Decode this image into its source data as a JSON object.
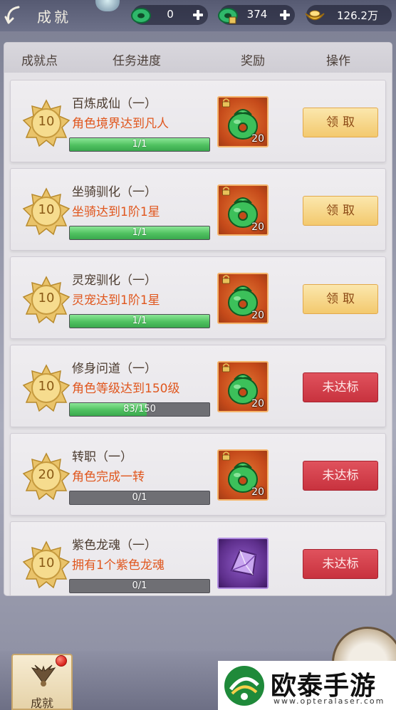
{
  "header": {
    "title": "成就",
    "currencies": [
      {
        "icon": "green-jade-icon",
        "value": "0"
      },
      {
        "icon": "bound-jade-icon",
        "value": "374"
      },
      {
        "icon": "gold-ingot-icon",
        "value": "126.2万"
      }
    ]
  },
  "table": {
    "columns": [
      "成就点",
      "任务进度",
      "奖励",
      "操作"
    ]
  },
  "achievements": [
    {
      "points": "10",
      "title": "百炼成仙（一）",
      "desc": "角色境界达到凡人",
      "progress_text": "1/1",
      "progress": 1.0,
      "reward_icon": "jade-pouch-icon",
      "reward_count": "20",
      "action": "领取",
      "state": "claimable"
    },
    {
      "points": "10",
      "title": "坐骑驯化（一）",
      "desc": "坐骑达到1阶1星",
      "progress_text": "1/1",
      "progress": 1.0,
      "reward_icon": "jade-pouch-icon",
      "reward_count": "20",
      "action": "领取",
      "state": "claimable"
    },
    {
      "points": "10",
      "title": "灵宠驯化（一）",
      "desc": "灵宠达到1阶1星",
      "progress_text": "1/1",
      "progress": 1.0,
      "reward_icon": "jade-pouch-icon",
      "reward_count": "20",
      "action": "领取",
      "state": "claimable"
    },
    {
      "points": "10",
      "title": "修身问道（一）",
      "desc": "角色等级达到150级",
      "progress_text": "83/150",
      "progress": 0.553,
      "reward_icon": "jade-pouch-icon",
      "reward_count": "20",
      "action": "未达标",
      "state": "locked"
    },
    {
      "points": "20",
      "title": "转职（一）",
      "desc": "角色完成一转",
      "progress_text": "0/1",
      "progress": 0.0,
      "reward_icon": "jade-pouch-icon",
      "reward_count": "20",
      "action": "未达标",
      "state": "locked"
    },
    {
      "points": "10",
      "title": "紫色龙魂（一）",
      "desc": "拥有1个紫色龙魂",
      "progress_text": "0/1",
      "progress": 0.0,
      "reward_icon": "purple-crystal-icon",
      "reward_count": "",
      "action": "未达标",
      "state": "locked"
    }
  ],
  "bottom_tabs": [
    {
      "label": "成就",
      "icon": "wings-emblem-icon",
      "has_notification": true
    }
  ],
  "watermark": {
    "title": "欧泰手游网",
    "url": "www.opteralaser.com"
  },
  "colors": {
    "desc_orange": "#e0561d",
    "claim_button": "#f3c96e",
    "locked_button": "#c8323e",
    "progress_green": "#4fc160"
  }
}
